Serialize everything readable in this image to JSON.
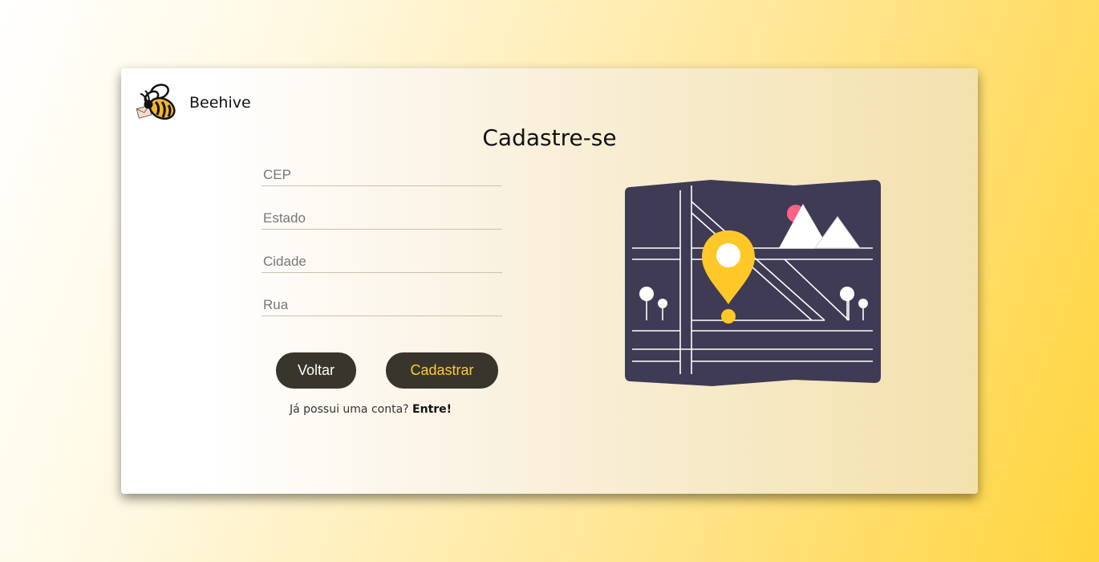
{
  "brand": {
    "name": "Beehive"
  },
  "page": {
    "title": "Cadastre-se"
  },
  "form": {
    "cep": {
      "placeholder": "CEP",
      "value": ""
    },
    "estado": {
      "placeholder": "Estado",
      "value": ""
    },
    "cidade": {
      "placeholder": "Cidade",
      "value": ""
    },
    "rua": {
      "placeholder": "Rua",
      "value": ""
    }
  },
  "buttons": {
    "back_label": "Voltar",
    "register_label": "Cadastrar"
  },
  "login": {
    "prompt": "Já possui uma conta?",
    "link_label": "Entre!"
  },
  "colors": {
    "accent": "#ffc93b",
    "button_dark": "#38352d",
    "map_bg": "#3f3b55",
    "pin": "#ffc828",
    "sun": "#ff6384"
  },
  "icons": {
    "logo": "bee-logo-icon",
    "illustration": "map-pin-illustration"
  }
}
